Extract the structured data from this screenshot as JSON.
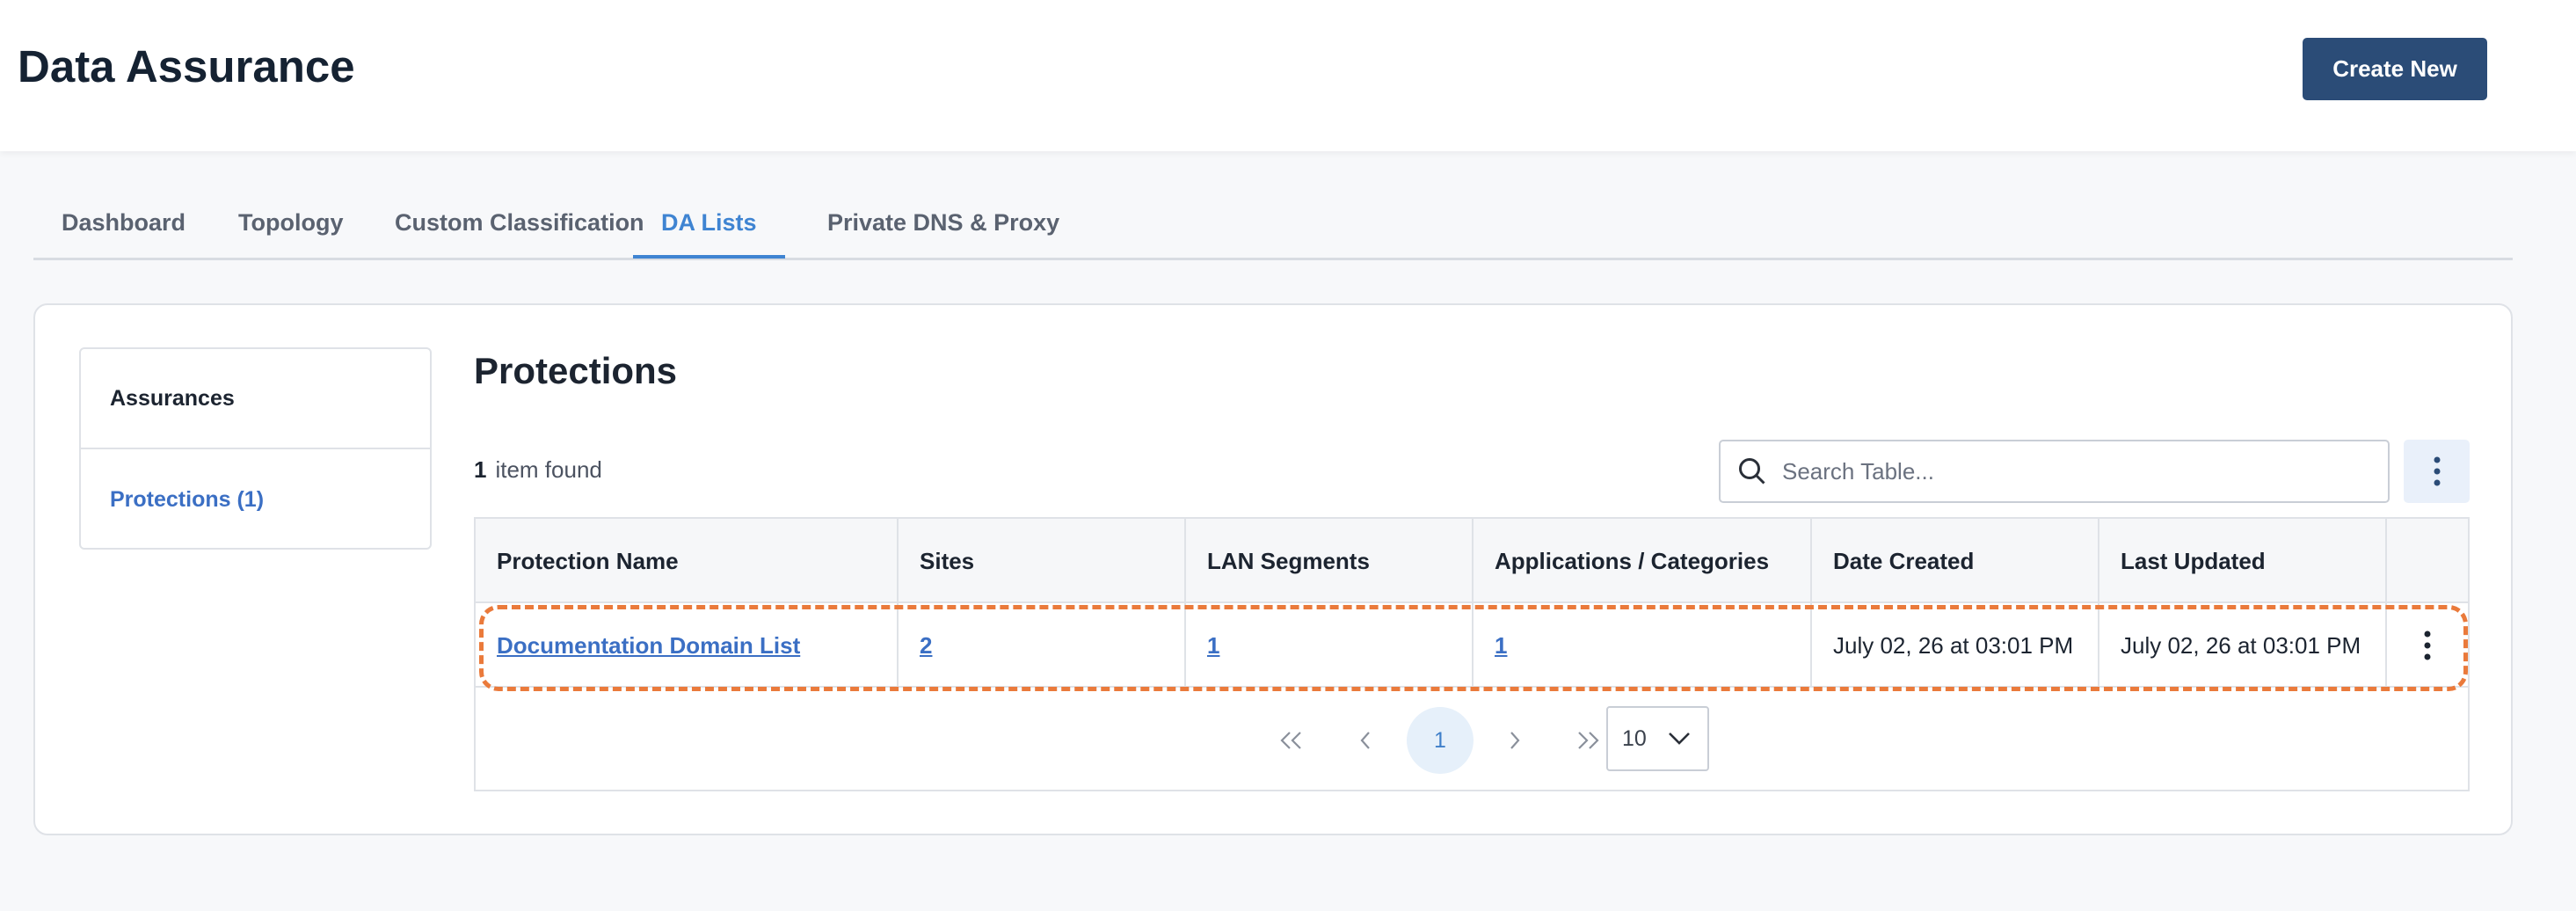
{
  "header": {
    "title": "Data Assurance",
    "create_label": "Create New"
  },
  "tabs": [
    {
      "label": "Dashboard"
    },
    {
      "label": "Topology"
    },
    {
      "label": "Custom Classification"
    },
    {
      "label": "DA Lists"
    },
    {
      "label": "Private DNS & Proxy"
    }
  ],
  "active_tab": "DA Lists",
  "sidenav": {
    "items": [
      {
        "label": "Assurances"
      },
      {
        "label": "Protections (1)"
      }
    ]
  },
  "main": {
    "title": "Protections",
    "count_number": "1",
    "count_text": "item found",
    "search_placeholder": "Search Table..."
  },
  "table": {
    "columns": [
      "Protection Name",
      "Sites",
      "LAN Segments",
      "Applications / Categories",
      "Date Created",
      "Last Updated",
      ""
    ],
    "rows": [
      {
        "name": "Documentation Domain List",
        "sites": "2",
        "lan_segments": "1",
        "applications": "1",
        "date_created": "July 02, 26 at 03:01 PM",
        "last_updated": "July 02, 26 at 03:01 PM"
      }
    ]
  },
  "pagination": {
    "current_page": "1",
    "page_size": "10"
  },
  "colors": {
    "brand": "#2b4c77",
    "accent": "#3f84d2",
    "highlight": "#ea7a3b"
  }
}
